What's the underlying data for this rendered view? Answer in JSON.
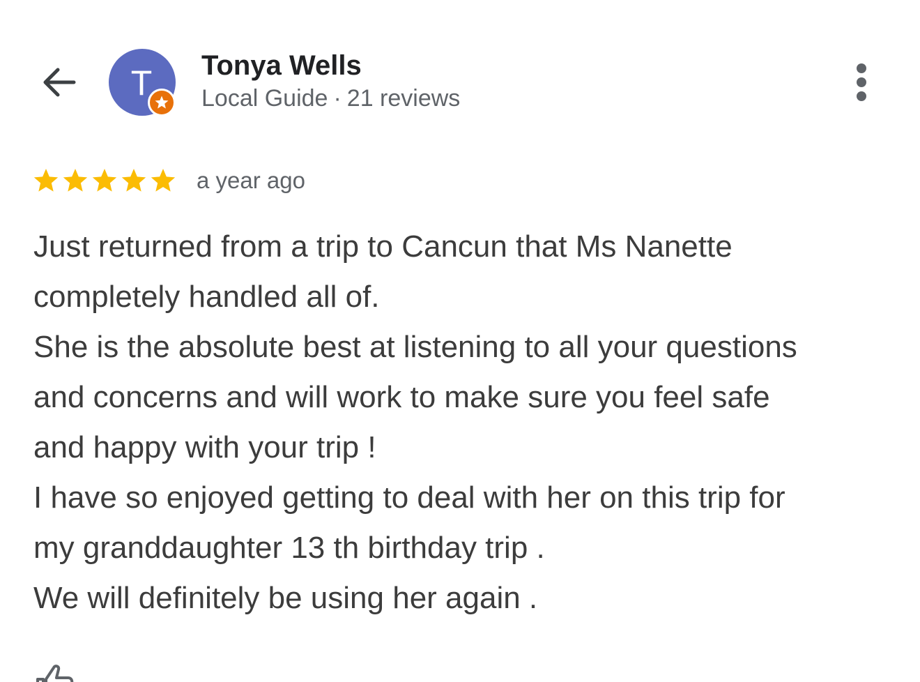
{
  "header": {
    "back_icon": "arrow-back-icon",
    "avatar_letter": "T",
    "avatar_color": "#5c6bc0",
    "badge_icon": "local-guide-star-icon",
    "badge_color": "#e8710a",
    "name": "Tonya Wells",
    "role": "Local Guide",
    "separator": "·",
    "review_count": "21 reviews",
    "more_icon": "more-vertical-icon"
  },
  "review": {
    "rating": 5,
    "rating_max": 5,
    "star_color": "#fbbc04",
    "date": "a year ago",
    "lines": [
      "Just returned from a trip to Cancun that Ms Nanette",
      "completely handled all of.",
      "She is the absolute best at listening to all your questions",
      "and concerns and will work to make sure you feel safe",
      "and happy with your trip !",
      "I have so enjoyed getting to deal with her on this trip for",
      "my granddaughter 13 th birthday trip .",
      "We will definitely be using her again ."
    ]
  },
  "footer": {
    "icon": "thumbs-up-icon"
  }
}
